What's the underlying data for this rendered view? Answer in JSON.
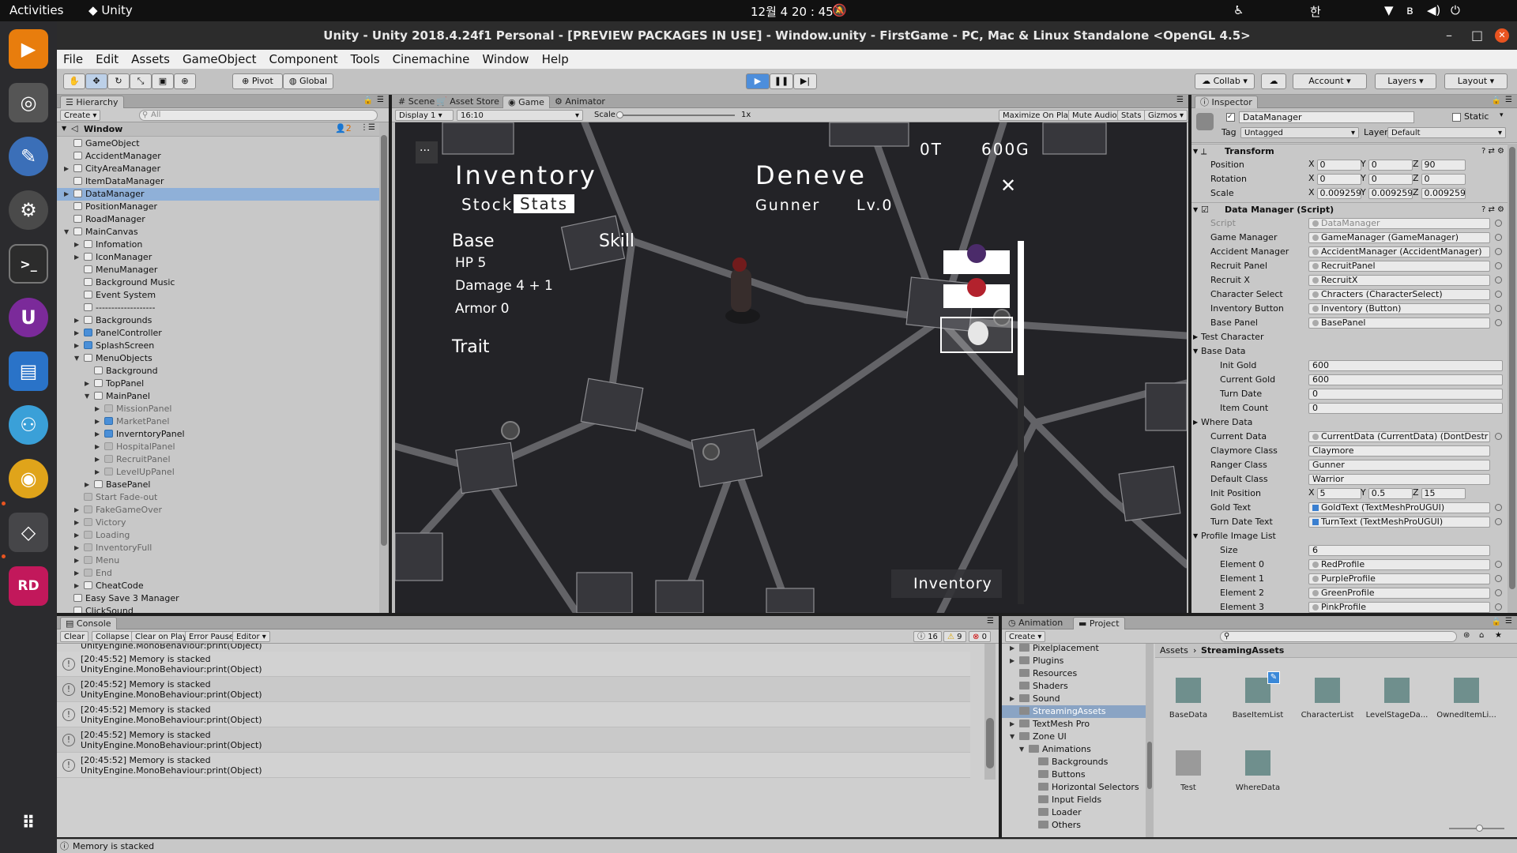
{
  "os": {
    "activities": "Activities",
    "app_name": "Unity",
    "clock": "12월 4  20 : 45",
    "input_lang": "한",
    "status_icons": [
      "accessibility-icon",
      "wifi-icon",
      "bluetooth-icon",
      "volume-icon",
      "power-icon"
    ],
    "dock_apps": [
      "vlc-icon",
      "screenshot-icon",
      "krita-icon",
      "settings-icon",
      "terminal-icon",
      "unity-hub-icon",
      "files-icon",
      "gitkraken-icon",
      "chrome-icon",
      "unity-icon",
      "rider-icon",
      "app-grid-icon"
    ]
  },
  "window": {
    "title": "Unity - Unity 2018.4.24f1 Personal - [PREVIEW PACKAGES IN USE] - Window.unity - FirstGame - PC, Mac & Linux Standalone <OpenGL 4.5>",
    "minimize": "–",
    "maximize": "□",
    "close": "✕"
  },
  "menu": [
    "File",
    "Edit",
    "Assets",
    "GameObject",
    "Component",
    "Tools",
    "Cinemachine",
    "Window",
    "Help"
  ],
  "toolbar": {
    "pivot": "Pivot",
    "global": "Global",
    "collab": "Collab",
    "account": "Account",
    "layers": "Layers",
    "layout": "Layout"
  },
  "hierarchy": {
    "tab": "Hierarchy",
    "create": "Create",
    "search_placeholder": "All",
    "scene": "Window",
    "scene_count": "2",
    "items": [
      {
        "label": "GameObject",
        "depth": 1,
        "arrow": "",
        "icon": "",
        "dim": false,
        "sel": false
      },
      {
        "label": "AccidentManager",
        "depth": 1,
        "arrow": "",
        "icon": "",
        "dim": false,
        "sel": false
      },
      {
        "label": "CityAreaManager",
        "depth": 1,
        "arrow": "▶",
        "icon": "",
        "dim": false,
        "sel": false
      },
      {
        "label": "ItemDataManager",
        "depth": 1,
        "arrow": "",
        "icon": "",
        "dim": false,
        "sel": false
      },
      {
        "label": "DataManager",
        "depth": 1,
        "arrow": "▶",
        "icon": "",
        "dim": false,
        "sel": true
      },
      {
        "label": "PositionManager",
        "depth": 1,
        "arrow": "",
        "icon": "",
        "dim": false,
        "sel": false
      },
      {
        "label": "RoadManager",
        "depth": 1,
        "arrow": "",
        "icon": "",
        "dim": false,
        "sel": false
      },
      {
        "label": "MainCanvas",
        "depth": 1,
        "arrow": "▼",
        "icon": "",
        "dim": false,
        "sel": false
      },
      {
        "label": "Infomation",
        "depth": 2,
        "arrow": "▶",
        "icon": "",
        "dim": false,
        "sel": false
      },
      {
        "label": "IconManager",
        "depth": 2,
        "arrow": "▶",
        "icon": "",
        "dim": false,
        "sel": false
      },
      {
        "label": "MenuManager",
        "depth": 2,
        "arrow": "",
        "icon": "",
        "dim": false,
        "sel": false
      },
      {
        "label": "Background Music",
        "depth": 2,
        "arrow": "",
        "icon": "",
        "dim": false,
        "sel": false
      },
      {
        "label": "Event System",
        "depth": 2,
        "arrow": "",
        "icon": "",
        "dim": false,
        "sel": false
      },
      {
        "label": "-------------------",
        "depth": 2,
        "arrow": "",
        "icon": "",
        "dim": false,
        "sel": false
      },
      {
        "label": "Backgrounds",
        "depth": 2,
        "arrow": "▶",
        "icon": "",
        "dim": false,
        "sel": false
      },
      {
        "label": "PanelController",
        "depth": 2,
        "arrow": "▶",
        "icon": "blue",
        "dim": false,
        "sel": false
      },
      {
        "label": "SplashScreen",
        "depth": 2,
        "arrow": "▶",
        "icon": "blue",
        "dim": false,
        "sel": false
      },
      {
        "label": "MenuObjects",
        "depth": 2,
        "arrow": "▼",
        "icon": "",
        "dim": false,
        "sel": false
      },
      {
        "label": "Background",
        "depth": 3,
        "arrow": "",
        "icon": "",
        "dim": false,
        "sel": false
      },
      {
        "label": "TopPanel",
        "depth": 3,
        "arrow": "▶",
        "icon": "",
        "dim": false,
        "sel": false
      },
      {
        "label": "MainPanel",
        "depth": 3,
        "arrow": "▼",
        "icon": "",
        "dim": false,
        "sel": false
      },
      {
        "label": "MissionPanel",
        "depth": 4,
        "arrow": "▶",
        "icon": "gray",
        "dim": true,
        "sel": false
      },
      {
        "label": "MarketPanel",
        "depth": 4,
        "arrow": "▶",
        "icon": "blue",
        "dim": true,
        "sel": false
      },
      {
        "label": "InverntoryPanel",
        "depth": 4,
        "arrow": "▶",
        "icon": "blue",
        "dim": false,
        "sel": false
      },
      {
        "label": "HospitalPanel",
        "depth": 4,
        "arrow": "▶",
        "icon": "gray",
        "dim": true,
        "sel": false
      },
      {
        "label": "RecruitPanel",
        "depth": 4,
        "arrow": "▶",
        "icon": "gray",
        "dim": true,
        "sel": false
      },
      {
        "label": "LevelUpPanel",
        "depth": 4,
        "arrow": "▶",
        "icon": "gray",
        "dim": true,
        "sel": false
      },
      {
        "label": "BasePanel",
        "depth": 3,
        "arrow": "▶",
        "icon": "",
        "dim": false,
        "sel": false
      },
      {
        "label": "Start Fade-out",
        "depth": 2,
        "arrow": "",
        "icon": "gray",
        "dim": true,
        "sel": false
      },
      {
        "label": "FakeGameOver",
        "depth": 2,
        "arrow": "▶",
        "icon": "gray",
        "dim": true,
        "sel": false
      },
      {
        "label": "Victory",
        "depth": 2,
        "arrow": "▶",
        "icon": "gray",
        "dim": true,
        "sel": false
      },
      {
        "label": "Loading",
        "depth": 2,
        "arrow": "▶",
        "icon": "gray",
        "dim": true,
        "sel": false
      },
      {
        "label": "InventoryFull",
        "depth": 2,
        "arrow": "▶",
        "icon": "gray",
        "dim": true,
        "sel": false
      },
      {
        "label": "Menu",
        "depth": 2,
        "arrow": "▶",
        "icon": "gray",
        "dim": true,
        "sel": false
      },
      {
        "label": "End",
        "depth": 2,
        "arrow": "▶",
        "icon": "gray",
        "dim": true,
        "sel": false
      },
      {
        "label": "CheatCode",
        "depth": 2,
        "arrow": "▶",
        "icon": "",
        "dim": false,
        "sel": false
      },
      {
        "label": "Easy Save 3 Manager",
        "depth": 1,
        "arrow": "",
        "icon": "",
        "dim": false,
        "sel": false
      },
      {
        "label": "ClickSound",
        "depth": 1,
        "arrow": "",
        "icon": "",
        "dim": false,
        "sel": false
      }
    ]
  },
  "view_tabs": [
    "Scene",
    "Asset Store",
    "Game",
    "Animator"
  ],
  "game_bar": {
    "display": "Display 1",
    "aspect": "16:10",
    "scale_label": "Scale",
    "scale_value": "1x",
    "buttons": [
      "Maximize On Play",
      "Mute Audio",
      "Stats",
      "Gizmos"
    ]
  },
  "game": {
    "turns": "0T",
    "gold": "600G",
    "inventory_title": "Inventory",
    "tab_stock": "Stock",
    "tab_stats": "Stats",
    "character_name": "Deneve",
    "character_class": "Gunner",
    "level": "Lv.0",
    "base_heading": "Base",
    "skill_heading": "Skill",
    "stats": [
      "HP 5",
      "Damage 4 + 1",
      "Armor 0"
    ],
    "trait_heading": "Trait",
    "close": "✕",
    "menu_dots": "···",
    "inventory_button": "Inventory"
  },
  "inspector": {
    "tab": "Inspector",
    "object_name": "DataManager",
    "static_label": "Static",
    "tag_label": "Tag",
    "tag_value": "Untagged",
    "layer_label": "Layer",
    "layer_value": "Default",
    "transform": {
      "header": "Transform",
      "rows": [
        {
          "label": "Position",
          "x": "0",
          "y": "0",
          "z": "90"
        },
        {
          "label": "Rotation",
          "x": "0",
          "y": "0",
          "z": "0"
        },
        {
          "label": "Scale",
          "x": "0.0092590",
          "y": "0.0092590",
          "z": "0.0092590"
        }
      ]
    },
    "script_header": "Data Manager (Script)",
    "fields": [
      {
        "label": "Script",
        "value": "DataManager",
        "kind": "ref",
        "dim": true
      },
      {
        "label": "Game Manager",
        "value": "GameManager (GameManager)",
        "kind": "ref"
      },
      {
        "label": "Accident Manager",
        "value": "AccidentManager (AccidentManager)",
        "kind": "ref"
      },
      {
        "label": "Recruit Panel",
        "value": "RecruitPanel",
        "kind": "ref"
      },
      {
        "label": "Recruit X",
        "value": "RecruitX",
        "kind": "ref"
      },
      {
        "label": "Character Select",
        "value": "Chracters (CharacterSelect)",
        "kind": "ref"
      },
      {
        "label": "Inventory Button",
        "value": "Inventory (Button)",
        "kind": "ref"
      },
      {
        "label": "Base Panel",
        "value": "BasePanel",
        "kind": "ref"
      }
    ],
    "test_character": "Test Character",
    "base_data": "Base Data",
    "base_fields": [
      {
        "label": "Init Gold",
        "value": "600"
      },
      {
        "label": "Current Gold",
        "value": "600"
      },
      {
        "label": "Turn Date",
        "value": "0"
      },
      {
        "label": "Item Count",
        "value": "0"
      }
    ],
    "where_data": "Where Data",
    "fields2": [
      {
        "label": "Current Data",
        "value": "CurrentData (CurrentData) (DontDestr",
        "kind": "ref"
      },
      {
        "label": "Claymore Class",
        "value": "Claymore",
        "kind": "text"
      },
      {
        "label": "Ranger Class",
        "value": "Gunner",
        "kind": "text"
      },
      {
        "label": "Default Class",
        "value": "Warrior",
        "kind": "text"
      }
    ],
    "init_position": {
      "label": "Init Position",
      "x": "5",
      "y": "0.5",
      "z": "15"
    },
    "fields3": [
      {
        "label": "Gold Text",
        "value": "GoldText (TextMeshProUGUI)",
        "kind": "refb"
      },
      {
        "label": "Turn Date Text",
        "value": "TurnText (TextMeshProUGUI)",
        "kind": "refb"
      }
    ],
    "profile_list": "Profile Image List",
    "profile_size": {
      "label": "Size",
      "value": "6"
    },
    "profile_elements": [
      {
        "label": "Element 0",
        "value": "RedProfile"
      },
      {
        "label": "Element 1",
        "value": "PurpleProfile"
      },
      {
        "label": "Element 2",
        "value": "GreenProfile"
      },
      {
        "label": "Element 3",
        "value": "PinkProfile"
      }
    ]
  },
  "console": {
    "tab": "Console",
    "buttons": [
      "Clear",
      "Collapse",
      "Clear on Play",
      "Error Pause",
      "Editor"
    ],
    "count_info": "16",
    "count_warn": "9",
    "count_error": "0",
    "cut_line": "UnityEngine.MonoBehaviour:print(Object)",
    "entries": [
      {
        "time": "[20:45:52] Memory is stacked",
        "trace": "UnityEngine.MonoBehaviour:print(Object)"
      },
      {
        "time": "[20:45:52] Memory is stacked",
        "trace": "UnityEngine.MonoBehaviour:print(Object)"
      },
      {
        "time": "[20:45:52] Memory is stacked",
        "trace": "UnityEngine.MonoBehaviour:print(Object)"
      },
      {
        "time": "[20:45:52] Memory is stacked",
        "trace": "UnityEngine.MonoBehaviour:print(Object)"
      },
      {
        "time": "[20:45:52] Memory is stacked",
        "trace": "UnityEngine.MonoBehaviour:print(Object)"
      }
    ]
  },
  "project": {
    "tabs": [
      "Animation",
      "Project"
    ],
    "create": "Create",
    "breadcrumb_root": "Assets",
    "breadcrumb_current": "StreamingAssets",
    "folders": [
      {
        "label": "Pixelplacement",
        "depth": 0,
        "arrow": "▶",
        "sel": false
      },
      {
        "label": "Plugins",
        "depth": 0,
        "arrow": "▶",
        "sel": false
      },
      {
        "label": "Resources",
        "depth": 0,
        "arrow": "",
        "sel": false
      },
      {
        "label": "Shaders",
        "depth": 0,
        "arrow": "",
        "sel": false
      },
      {
        "label": "Sound",
        "depth": 0,
        "arrow": "▶",
        "sel": false
      },
      {
        "label": "StreamingAssets",
        "depth": 0,
        "arrow": "",
        "sel": true
      },
      {
        "label": "TextMesh Pro",
        "depth": 0,
        "arrow": "▶",
        "sel": false
      },
      {
        "label": "Zone UI",
        "depth": 0,
        "arrow": "▼",
        "sel": false
      },
      {
        "label": "Animations",
        "depth": 1,
        "arrow": "▼",
        "sel": false
      },
      {
        "label": "Backgrounds",
        "depth": 2,
        "arrow": "",
        "sel": false
      },
      {
        "label": "Buttons",
        "depth": 2,
        "arrow": "",
        "sel": false
      },
      {
        "label": "Horizontal Selectors",
        "depth": 2,
        "arrow": "",
        "sel": false
      },
      {
        "label": "Input Fields",
        "depth": 2,
        "arrow": "",
        "sel": false
      },
      {
        "label": "Loader",
        "depth": 2,
        "arrow": "",
        "sel": false
      },
      {
        "label": "Others",
        "depth": 2,
        "arrow": "",
        "sel": false
      }
    ],
    "assets": [
      {
        "label": "BaseData"
      },
      {
        "label": "BaseItemList"
      },
      {
        "label": "CharacterList"
      },
      {
        "label": "LevelStageDa..."
      },
      {
        "label": "OwnedItemLi..."
      },
      {
        "label": "Test"
      },
      {
        "label": "WhereData"
      }
    ]
  },
  "status_bar": "Memory is stacked"
}
